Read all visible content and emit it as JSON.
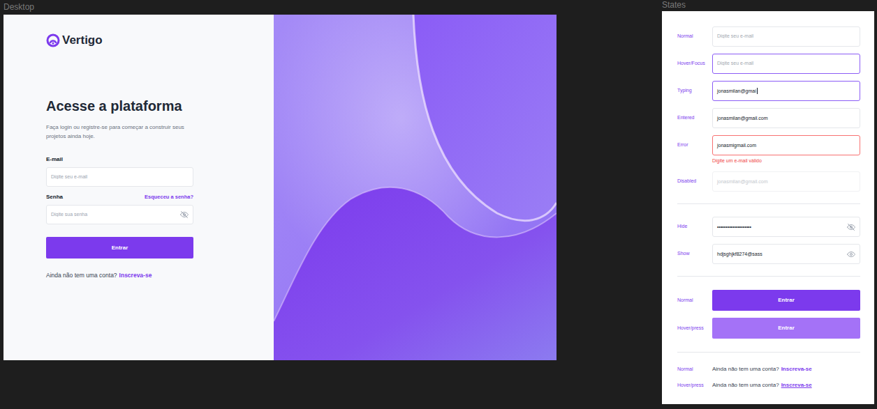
{
  "desktop": {
    "frame_label": "Desktop",
    "brand": "Vertigo",
    "heading": "Acesse a plataforma",
    "subtitle": "Faça login ou registre-se para começar a construir seus projetos ainda hoje.",
    "email": {
      "label": "E-mail",
      "placeholder": "Digite seu e-mail"
    },
    "password": {
      "label": "Senha",
      "placeholder": "Digite sua senha",
      "forgot": "Esqueceu a senha?",
      "visible": false
    },
    "submit": "Entrar",
    "signup": {
      "prompt": "Ainda não tem uma conta?",
      "link": "Inscreva-se"
    }
  },
  "states": {
    "frame_label": "States",
    "email_states": [
      {
        "label": "Normal",
        "state": "normal",
        "placeholder": "Digite seu e-mail"
      },
      {
        "label": "Hover/Focus",
        "state": "focus",
        "placeholder": "Digite seu e-mail"
      },
      {
        "label": "Typing",
        "state": "typing",
        "value": "jonasmilan@gmai"
      },
      {
        "label": "Entered",
        "state": "entered",
        "value": "jonasmilan@gmail.com"
      },
      {
        "label": "Error",
        "state": "error",
        "value": "jonasmigmail.com",
        "error": "Digite um e-mail válido"
      },
      {
        "label": "Disabled",
        "state": "disabled",
        "value": "jonasmilan@gmail.com"
      }
    ],
    "password_states": [
      {
        "label": "Hide",
        "value": "••••••••••••••••••••",
        "visible": false
      },
      {
        "label": "Show",
        "value": "hdjsghjkf8274@sass",
        "visible": true
      }
    ],
    "button_states": [
      {
        "label": "Normal",
        "text": "Entrar",
        "state": "normal"
      },
      {
        "label": "Hover/press",
        "text": "Entrar",
        "state": "hover"
      }
    ],
    "link_states": [
      {
        "label": "Normal",
        "prompt": "Ainda não tem uma conta?",
        "link": "Inscreva-se",
        "state": "normal"
      },
      {
        "label": "Hover/press",
        "prompt": "Ainda não tem uma conta?",
        "link": "Inscreva-se",
        "state": "hover"
      }
    ]
  }
}
